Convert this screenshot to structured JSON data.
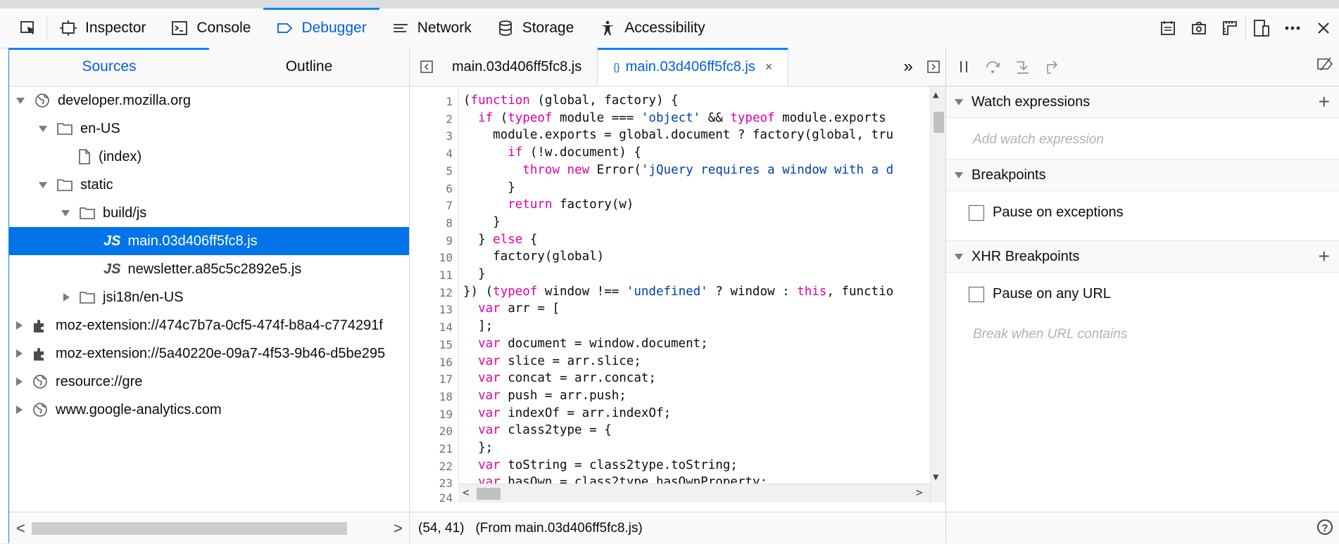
{
  "toolbar": {
    "tabs": [
      {
        "label": "Inspector",
        "icon": "inspector-icon"
      },
      {
        "label": "Console",
        "icon": "console-icon"
      },
      {
        "label": "Debugger",
        "icon": "debugger-icon",
        "selected": true
      },
      {
        "label": "Network",
        "icon": "network-icon"
      },
      {
        "label": "Storage",
        "icon": "storage-icon"
      },
      {
        "label": "Accessibility",
        "icon": "accessibility-icon"
      }
    ],
    "right_icons": [
      "split-console-icon",
      "screenshot-icon",
      "rulers-icon",
      "responsive-design-icon",
      "more-options-icon",
      "close-icon"
    ]
  },
  "left_panel": {
    "tabs": [
      "Sources",
      "Outline"
    ],
    "active_tab": "Sources",
    "tree": [
      {
        "label": "developer.mozilla.org",
        "depth": 0,
        "icon": "globe-icon",
        "expanded": true
      },
      {
        "label": "en-US",
        "depth": 1,
        "icon": "folder-icon",
        "expanded": true
      },
      {
        "label": "(index)",
        "depth": 2,
        "icon": "file-icon"
      },
      {
        "label": "static",
        "depth": 1,
        "icon": "folder-icon",
        "expanded": true
      },
      {
        "label": "build/js",
        "depth": 2,
        "icon": "folder-icon",
        "expanded": true
      },
      {
        "label": "main.03d406ff5fc8.js",
        "depth": 3,
        "icon": "js-file-icon",
        "selected": true
      },
      {
        "label": "newsletter.a85c5c2892e5.js",
        "depth": 3,
        "icon": "js-file-icon"
      },
      {
        "label": "jsi18n/en-US",
        "depth": 2,
        "icon": "folder-icon",
        "expanded": false
      },
      {
        "label": "moz-extension://474c7b7a-0cf5-474f-b8a4-c774291f",
        "depth": 0,
        "icon": "extension-icon",
        "expanded": false
      },
      {
        "label": "moz-extension://5a40220e-09a7-4f53-9b46-d5be295",
        "depth": 0,
        "icon": "extension-icon",
        "expanded": false
      },
      {
        "label": "resource://gre",
        "depth": 0,
        "icon": "globe-icon",
        "expanded": false
      },
      {
        "label": "www.google-analytics.com",
        "depth": 0,
        "icon": "globe-icon",
        "expanded": false
      }
    ]
  },
  "editor": {
    "tabs": [
      {
        "label": "main.03d406ff5fc8.js",
        "active": false
      },
      {
        "label": "main.03d406ff5fc8.js",
        "active": true,
        "pretty": "{}",
        "close": "×"
      }
    ],
    "more_tabs": "»",
    "lines": [
      "(function (global, factory) {",
      "  if (typeof module === 'object' && typeof module.exports",
      "    module.exports = global.document ? factory(global, tru",
      "      if (!w.document) {",
      "        throw new Error('jQuery requires a window with a d",
      "      }",
      "      return factory(w)",
      "    }",
      "  } else {",
      "    factory(global)",
      "  }",
      "}) (typeof window !== 'undefined' ? window : this, functio",
      "  var arr = [",
      "  ];",
      "  var document = window.document;",
      "  var slice = arr.slice;",
      "  var concat = arr.concat;",
      "  var push = arr.push;",
      "  var indexOf = arr.indexOf;",
      "  var class2type = {",
      "  };",
      "  var toString = class2type.toString;",
      "  var hasOwn = class2type.hasOwnProperty;",
      ""
    ],
    "status_position": "(54, 41)",
    "status_source": "(From main.03d406ff5fc8.js)"
  },
  "right_panel": {
    "watch_title": "Watch expressions",
    "watch_placeholder": "Add watch expression",
    "breakpoints_title": "Breakpoints",
    "pause_exceptions": "Pause on exceptions",
    "xhr_title": "XHR Breakpoints",
    "pause_any_url": "Pause on any URL",
    "break_url_placeholder": "Break when URL contains",
    "plus": "+",
    "help": "?"
  }
}
